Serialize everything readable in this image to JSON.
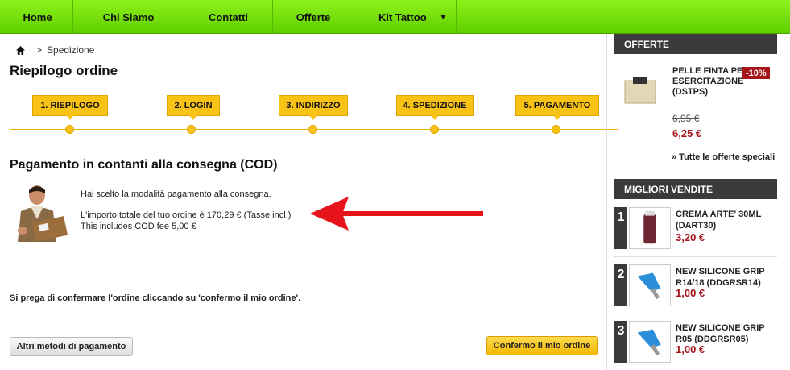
{
  "nav": {
    "items": [
      "Home",
      "Chi Siamo",
      "Contatti",
      "Offerte",
      "Kit Tattoo"
    ],
    "dropdown_icon": "caret-down-icon"
  },
  "breadcrumb": {
    "home_icon": "home-icon",
    "separator": ">",
    "current": "Spedizione"
  },
  "page_title": "Riepilogo ordine",
  "steps": [
    "1. RIEPILOGO",
    "2. LOGIN",
    "3. INDIRIZZO",
    "4. SPEDIZIONE",
    "5. PAGAMENTO"
  ],
  "payment": {
    "title": "Pagamento in contanti alla consegna (COD)",
    "line1": "Hai scelto la modalità pagamento alla consegna.",
    "line2": "L'importo totale del tuo ordine è 170,29 € (Tasse incl.)",
    "line3": "This includes COD fee 5,00 €",
    "confirm_note": "Si prega di confermare l'ordine cliccando su 'confermo il mio ordine'."
  },
  "buttons": {
    "other_methods": "Altri metodi di pagamento",
    "confirm": "Confermo il mio ordine"
  },
  "sidebar": {
    "offers": {
      "title": "OFFERTE",
      "product_name": "Pelle finta per esercitazione (DSTPS)",
      "discount": "-10%",
      "old_price": "6,95 €",
      "new_price": "6,25 €",
      "all_offers_link": "» Tutte le offerte speciali"
    },
    "best_sellers": {
      "title": "MIGLIORI VENDITE",
      "items": [
        {
          "rank": "1",
          "name": "CREMA ARTE' 30ml (DART30)",
          "price": "3,20 €"
        },
        {
          "rank": "2",
          "name": "NEW SILICONE GRIP R14/18 (DDGRSR14)",
          "price": "1,00 €"
        },
        {
          "rank": "3",
          "name": "NEW SILICONE GRIP R05 (DDGRSR05)",
          "price": "1,00 €"
        }
      ]
    }
  },
  "colors": {
    "nav_green": "#7ee30f",
    "step_yellow": "#f9c316",
    "price_red": "#a4161a",
    "arrow_red": "#e8141c"
  }
}
